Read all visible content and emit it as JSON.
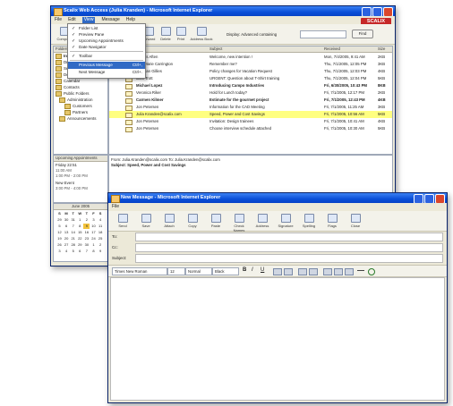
{
  "owa": {
    "title": "Scalix Web Access (Julia Kranden) - Microsoft Internet Explorer",
    "menu": [
      "File",
      "Edit",
      "View",
      "Message",
      "Help"
    ],
    "brand": "SCALIX",
    "toolbar": [
      "Compose",
      "Reply",
      "Reply All",
      "Forward",
      "Delete",
      "Print",
      "Address Book"
    ],
    "search_label": "Display: Advanced containing",
    "search_button": "Find",
    "view_menu": {
      "items": [
        {
          "label": "Folder List",
          "checked": true
        },
        {
          "label": "Preview Pane",
          "checked": true
        },
        {
          "label": "Upcoming Appointments",
          "checked": true
        },
        {
          "label": "Date Navigator",
          "checked": true
        },
        {
          "label": "Toolbar",
          "checked": true
        },
        {
          "label": "Previous Message",
          "shortcut": "Ctrl+,"
        },
        {
          "label": "Next Message",
          "shortcut": "Ctrl+."
        }
      ]
    },
    "folders_header": "Folders",
    "folders": [
      "Inbox",
      "Drafts",
      "Sent Items",
      "Deleted Items",
      "Calendar",
      "Contacts",
      "Public Folders",
      "Administration",
      "Customers",
      "Partners",
      "Announcements"
    ],
    "upcoming": {
      "header": "Upcoming Appointments",
      "items": [
        "Friday 22:51",
        "11:00 AM",
        "1:00 PM - 2:00 PM",
        "New Event",
        "3:00 PM - 4:00 PM"
      ]
    },
    "calendar": {
      "month": "June 2005",
      "weekdays": [
        "S",
        "M",
        "T",
        "W",
        "T",
        "F",
        "S"
      ],
      "weeks": [
        [
          "29",
          "30",
          "31",
          "1",
          "2",
          "3",
          "4"
        ],
        [
          "5",
          "6",
          "7",
          "8",
          "9",
          "10",
          "11"
        ],
        [
          "12",
          "13",
          "14",
          "15",
          "16",
          "17",
          "18"
        ],
        [
          "19",
          "20",
          "21",
          "22",
          "23",
          "24",
          "25"
        ],
        [
          "26",
          "27",
          "28",
          "29",
          "30",
          "1",
          "2"
        ],
        [
          "3",
          "4",
          "5",
          "6",
          "7",
          "8",
          "9"
        ]
      ],
      "today": "9"
    },
    "message_list": {
      "columns": [
        "From",
        "Subject",
        "Received",
        "Size"
      ],
      "rows": [
        {
          "from": "Dennis Aften",
          "subject": "Welcome, new intention !",
          "received": "Mon, 7/4/2005, 9:41 AM",
          "size": "2KB"
        },
        {
          "from": "Ann-Marie Carrington",
          "subject": "Remember me?",
          "received": "Thu, 7/1/2005, 12:05 PM",
          "size": "3KB"
        },
        {
          "from": "Stephan Gillies",
          "subject": "Policy changes for Vacation Request",
          "received": "Thu, 7/1/2005, 12:03 PM",
          "size": "4KB"
        },
        {
          "from": "Jack Trott",
          "subject": "URGENT: Question about T-Shirt training",
          "received": "Thu, 7/1/2005, 12:04 PM",
          "size": "5KB"
        },
        {
          "from": "Michael Lopez",
          "subject": "Introducing Campo Industries",
          "received": "Fri, 6/30/2005, 10:43 PM",
          "size": "8KB"
        },
        {
          "from": "Veronica Riker",
          "subject": "Hold for Lunch today?",
          "received": "Fri, 7/1/2005, 12:17 PM",
          "size": "2KB"
        },
        {
          "from": "Carmen Kilmer",
          "subject": "Estimate for the gourmet project",
          "received": "Fri, 7/1/2005, 12:43 PM",
          "size": "4KB"
        },
        {
          "from": "Jon Petersen",
          "subject": "Information for the CAD Meeting",
          "received": "Fri, 7/1/2005, 11:25 AM",
          "size": "3KB"
        },
        {
          "from": "Julia Kranden@scalix.com",
          "subject": "Speed, Power and Cost Savings",
          "received": "Fri, 7/1/2005, 10:56 AM",
          "size": "5KB"
        },
        {
          "from": "Jon Petersen",
          "subject": "Invitation: Design trainees",
          "received": "Fri, 7/1/2005, 10:41 AM",
          "size": "4KB"
        },
        {
          "from": "Jon Petersen",
          "subject": "Choose interview schedule attached",
          "received": "Fri, 7/1/2005, 10:30 AM",
          "size": "5KB"
        }
      ],
      "selected_index": 8
    },
    "preview": {
      "from_line": "From: Julia.Kranden@scalix.com  To: Julia.Kranden@scalix.com",
      "subject_line": "Subject: Speed, Power and Cost Savings"
    }
  },
  "compose": {
    "title": "New Message - Microsoft Internet Explorer",
    "menu": [
      "File"
    ],
    "toolbar": [
      "Send",
      "Save",
      "Attach",
      "Copy",
      "Paste",
      "Check Names",
      "Address",
      "Signature",
      "Spelling",
      "Flags",
      "Close"
    ],
    "fields": [
      "To:",
      "Cc:",
      "Subject:"
    ],
    "format": {
      "font": "Times New Roman",
      "size": "12",
      "style": "Normal",
      "color": "Black"
    },
    "format_buttons": [
      "B",
      "I",
      "U"
    ]
  },
  "colors": {
    "selection": "#ffff80",
    "menu_highlight": "#316ac5",
    "brand": "#c62828",
    "titlebar": "#0a4fd8"
  }
}
